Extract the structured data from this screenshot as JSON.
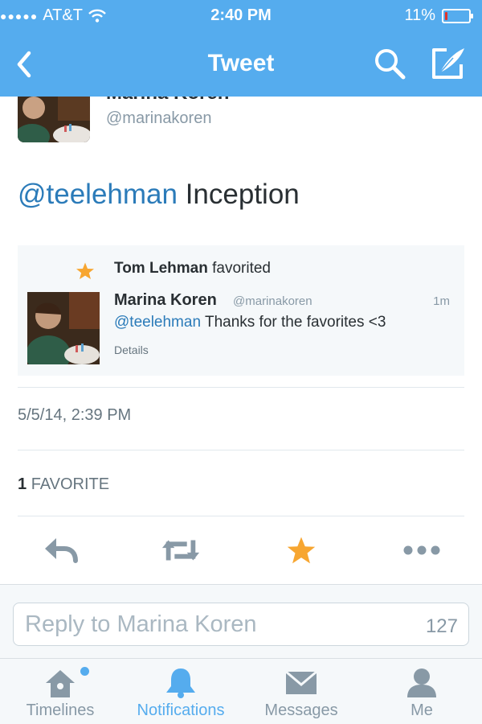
{
  "status_bar": {
    "carrier": "AT&T",
    "time": "2:40 PM",
    "battery_percent_label": "11%",
    "battery_level": 0.11
  },
  "nav": {
    "title": "Tweet",
    "icons": [
      "back-chevron-icon",
      "search-icon",
      "compose-icon"
    ]
  },
  "tweet": {
    "author_name": "Marina Koren",
    "author_handle": "@marinakoren",
    "mention": "@teelehman",
    "text": " Inception",
    "timestamp": "5/5/14, 2:39 PM",
    "favorite_count": "1",
    "favorite_label": "FAVORITE"
  },
  "activity_card": {
    "favoriter": "Tom Lehman",
    "action": "favorited",
    "name": "Marina Koren",
    "handle": "@marinakoren",
    "time": "1m",
    "mention": "@teelehman",
    "text": " Thanks for the favorites <3",
    "details_label": "Details"
  },
  "actions": [
    "reply-icon",
    "retweet-icon",
    "favorite-star-icon",
    "more-icon"
  ],
  "reply": {
    "placeholder": "Reply to Marina Koren",
    "char_count": "127"
  },
  "tabs": [
    {
      "label": "Timelines",
      "icon": "home-icon",
      "active": false
    },
    {
      "label": "Notifications",
      "icon": "bell-icon",
      "active": true
    },
    {
      "label": "Messages",
      "icon": "envelope-icon",
      "active": false
    },
    {
      "label": "Me",
      "icon": "person-icon",
      "active": false
    }
  ],
  "colors": {
    "brand_blue": "#55acee",
    "mention_blue": "#2b7bb9",
    "favorite_orange": "#f7a631",
    "icon_gray": "#8899a6",
    "battery_low_red": "#e0342b"
  }
}
